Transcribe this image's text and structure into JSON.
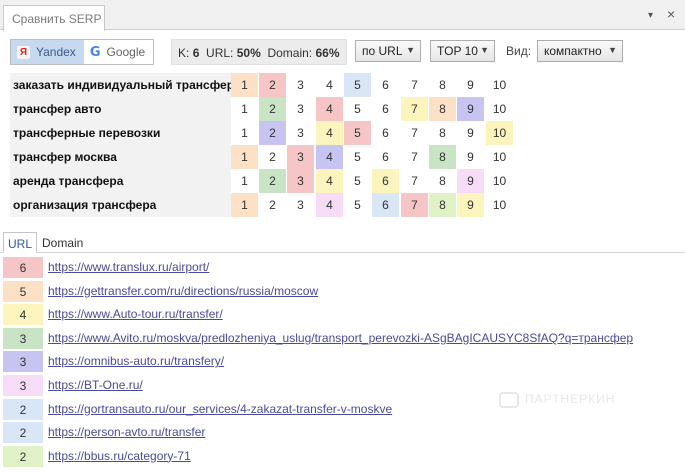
{
  "window": {
    "tab_title": "Сравнить SERP",
    "dropdown_glyph": "▾",
    "close_glyph": "×"
  },
  "toolbar": {
    "engines": [
      {
        "label": "Yandex",
        "icon": "yandex-icon",
        "active": true
      },
      {
        "label": "Google",
        "icon": "google-icon",
        "active": false
      }
    ],
    "stats": {
      "k_label": "K:",
      "k_value": "6",
      "url_label": "URL:",
      "url_value": "50%",
      "domain_label": "Domain:",
      "domain_value": "66%"
    },
    "compare_by": "по URL",
    "top": "TOP 10",
    "view_label": "Вид:",
    "view": "компактно"
  },
  "palette": {
    "red": "#f6c6c6",
    "orange": "#fde1c7",
    "yellow": "#fcf4bd",
    "green": "#c9e4c5",
    "purple": "#c8c4f1",
    "pink": "#f6dcf6",
    "blue": "#d8e6f6",
    "lime": "#e1f1c6"
  },
  "queries": [
    {
      "label": "заказать индивидуальный трансфер",
      "colors": [
        "orange",
        "red",
        null,
        null,
        "blue",
        null,
        null,
        null,
        null,
        null
      ]
    },
    {
      "label": "трансфер авто",
      "colors": [
        null,
        "green",
        null,
        "red",
        null,
        null,
        "yellow",
        "orange",
        "purple",
        null
      ]
    },
    {
      "label": "трансферные перевозки",
      "colors": [
        null,
        "purple",
        null,
        "yellow",
        "red",
        null,
        null,
        null,
        null,
        "yellow"
      ]
    },
    {
      "label": "трансфер москва",
      "colors": [
        "orange",
        null,
        "red",
        "purple",
        null,
        null,
        null,
        "green",
        null,
        null
      ]
    },
    {
      "label": "аренда трансфера",
      "colors": [
        null,
        "green",
        "red",
        "yellow",
        null,
        "yellow",
        null,
        null,
        "pink",
        null
      ]
    },
    {
      "label": "организация трансфера",
      "colors": [
        "orange",
        null,
        null,
        "pink",
        null,
        "blue",
        "red",
        "lime",
        "yellow",
        null
      ]
    }
  ],
  "positions": [
    "1",
    "2",
    "3",
    "4",
    "5",
    "6",
    "7",
    "8",
    "9",
    "10"
  ],
  "tabs": [
    {
      "label": "URL",
      "active": true
    },
    {
      "label": "Domain",
      "active": false
    }
  ],
  "urls": [
    {
      "count": "6",
      "color": "red",
      "url": "https://www.translux.ru/airport/"
    },
    {
      "count": "5",
      "color": "orange",
      "url": "https://gettransfer.com/ru/directions/russia/moscow"
    },
    {
      "count": "4",
      "color": "yellow",
      "url": "https://www.Auto-tour.ru/transfer/"
    },
    {
      "count": "3",
      "color": "green",
      "url": "https://www.Avito.ru/moskva/predlozheniya_uslug/transport_perevozki-ASgBAgICAUSYC8SfAQ?q=трансфер"
    },
    {
      "count": "3",
      "color": "purple",
      "url": "https://omnibus-auto.ru/transfery/"
    },
    {
      "count": "3",
      "color": "pink",
      "url": "https://BT-One.ru/"
    },
    {
      "count": "2",
      "color": "blue",
      "url": "https://gortransauto.ru/our_services/4-zakazat-transfer-v-moskve"
    },
    {
      "count": "2",
      "color": "blue",
      "url": "https://person-avto.ru/transfer"
    },
    {
      "count": "2",
      "color": "lime",
      "url": "https://bbus.ru/category-71"
    }
  ],
  "watermark": "ПАРТНЕРКИН"
}
